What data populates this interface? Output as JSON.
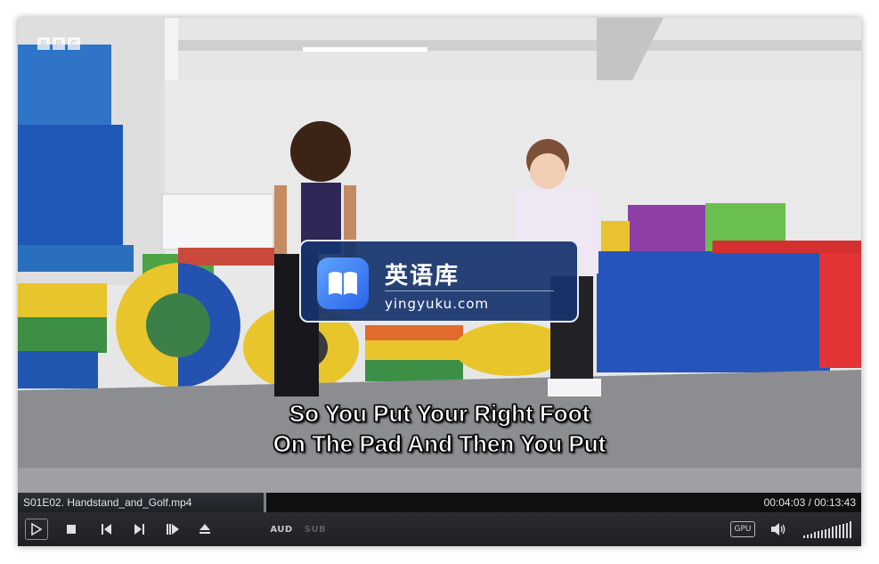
{
  "video": {
    "channel_logo": [
      "B",
      "B",
      "C"
    ],
    "watermark": {
      "title": "英语库",
      "url": "yingyuku.com"
    },
    "subtitles": [
      "So You Put Your Right Foot",
      "On The Pad And Then You Put"
    ]
  },
  "infobar": {
    "filename": "S01E02. Handstand_and_Golf.mp4",
    "timecode": "00:04:03 / 00:13:43",
    "progress": 0.295
  },
  "controls": {
    "audio_label": "AUD",
    "subtitle_label": "SUB",
    "gpu_label": "GPU",
    "volume_level": 1.0,
    "icons": [
      "play-icon",
      "stop-icon",
      "previous-icon",
      "next-icon",
      "frame-step-icon",
      "eject-icon",
      "speaker-icon"
    ]
  }
}
